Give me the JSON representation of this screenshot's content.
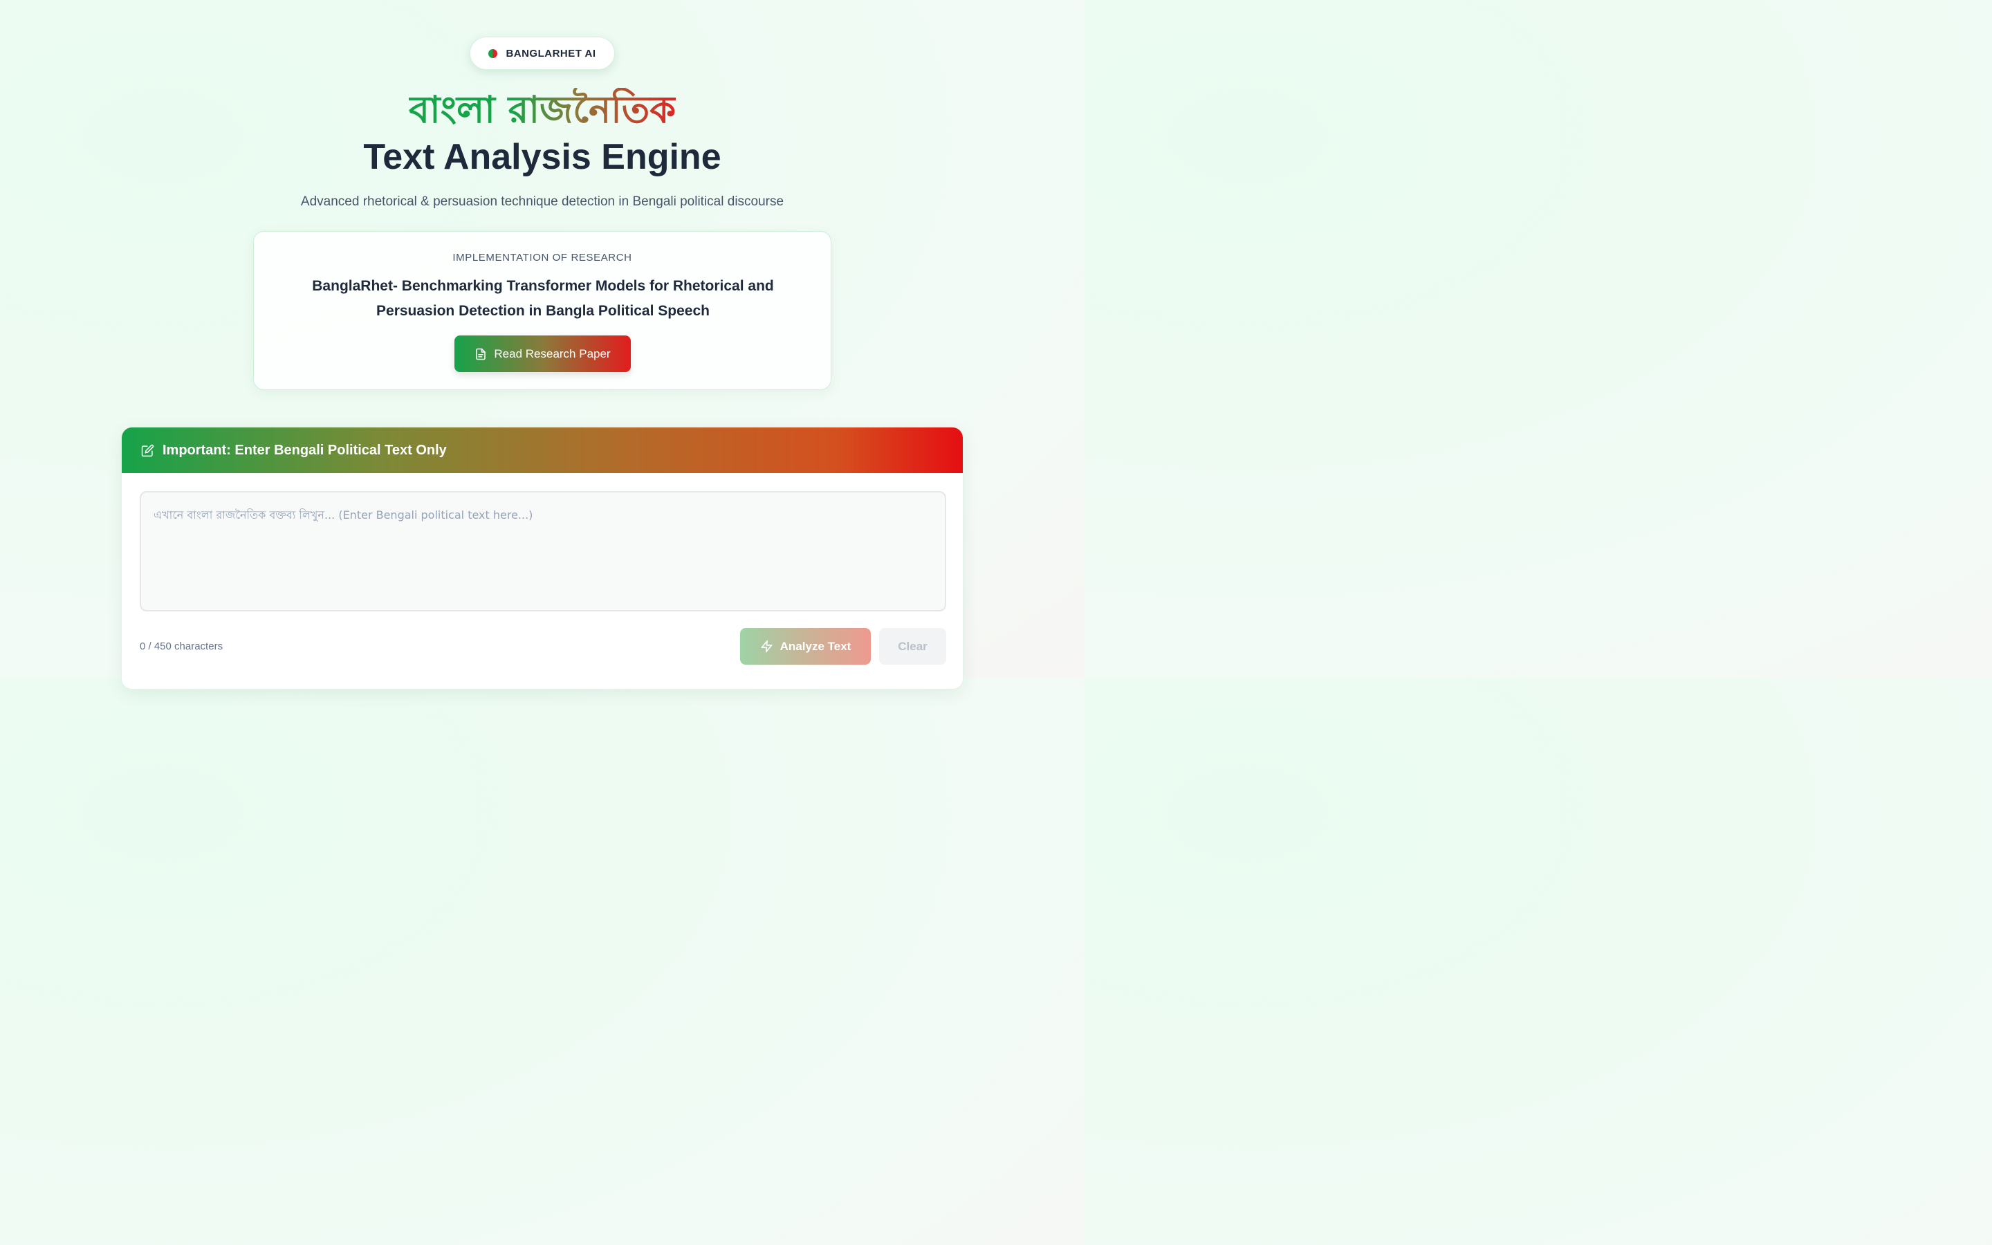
{
  "brand": {
    "label": "BANGLARHET AI"
  },
  "hero": {
    "title_bengali": "বাংলা রাজনৈতিক",
    "title_english": "Text Analysis Engine",
    "subtitle": "Advanced rhetorical & persuasion technique detection in Bengali political discourse"
  },
  "research": {
    "eyebrow": "IMPLEMENTATION OF RESEARCH",
    "title": "BanglaRhet- Benchmarking Transformer Models for Rhetorical and Persuasion Detection in Bangla Political Speech",
    "button_label": "Read Research Paper"
  },
  "input": {
    "header": "Important: Enter Bengali Political Text Only",
    "value": "",
    "placeholder": "এখানে বাংলা রাজনৈতিক বক্তব্য লিখুন... (Enter Bengali political text here...)",
    "char_count": "0 / 450 characters",
    "analyze_label": "Analyze Text",
    "clear_label": "Clear"
  },
  "colors": {
    "green": "#16a34a",
    "red": "#dc2626",
    "text_dark": "#1e293b"
  },
  "icons": {
    "brand": "flag-dot-icon",
    "paper": "document-icon",
    "header": "edit-icon",
    "analyze": "lightning-icon"
  }
}
